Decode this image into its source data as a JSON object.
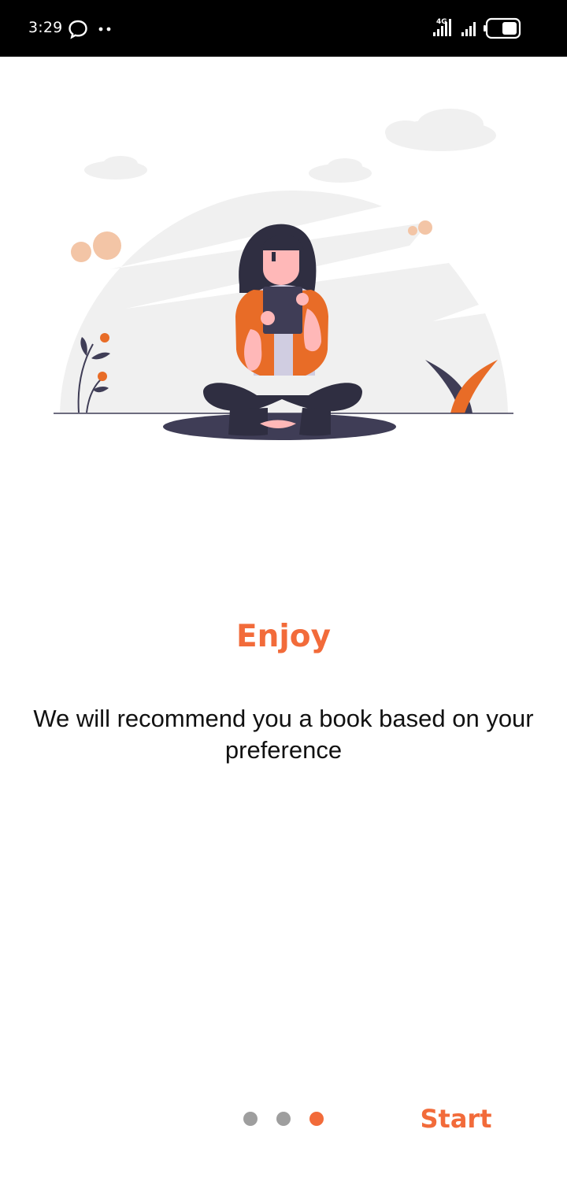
{
  "status_bar": {
    "time": "3:29",
    "icons": [
      "chat-bubble-icon",
      "more-dots-icon",
      "4g-signal-icon",
      "signal-icon",
      "battery-icon"
    ],
    "network_label": "4G"
  },
  "onboarding": {
    "title": "Enjoy",
    "description": "We will recommend you a book based on your preference",
    "illustration": "woman-reading-book-illustration",
    "page_count": 3,
    "current_page": 3,
    "start_label": "Start"
  },
  "colors": {
    "accent": "#f26b3a",
    "dot_inactive": "#9e9e9e",
    "text": "#111111",
    "status_bar_bg": "#000000"
  }
}
